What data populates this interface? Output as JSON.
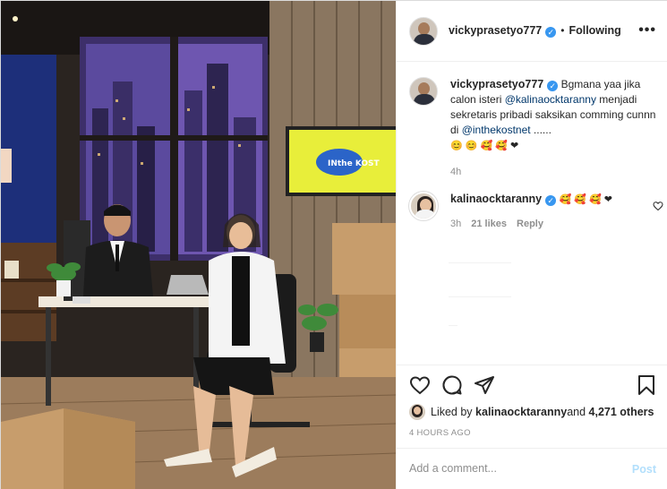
{
  "header": {
    "username": "vickyprasetyo777",
    "separator": "•",
    "follow_status": "Following",
    "more_label": "•••"
  },
  "caption": {
    "username": "vickyprasetyo777",
    "text_before": "Bgmana yaa jika calon isteri ",
    "mention1": "@kalinaocktaranny",
    "text_middle": " menjadi sekretaris pribadi saksikan comming cunnn di ",
    "mention2": "@inthekostnet",
    "text_after": " ......",
    "emojis": "😊 😊 🥰 🥰 ❤",
    "time": "4h"
  },
  "comment": {
    "username": "kalinaocktaranny",
    "emojis": "🥰 🥰 🥰 ❤",
    "time": "3h",
    "likes": "21 likes",
    "reply": "Reply"
  },
  "actions": {
    "liked_by_prefix": "Liked by ",
    "liked_by_user": "kalinaocktaranny",
    "liked_by_mid": " and ",
    "liked_by_count": "4,271 others",
    "posted_ago": "4 HOURS AGO"
  },
  "add_comment": {
    "placeholder": "Add a comment...",
    "post_label": "Post"
  },
  "photo": {
    "tv_text": "INthe KOST"
  },
  "colors": {
    "link": "#00376b",
    "verified": "#3897f0",
    "post_disabled": "#b2dffc",
    "muted": "#8e8e8e",
    "heart": "#ed4956"
  }
}
